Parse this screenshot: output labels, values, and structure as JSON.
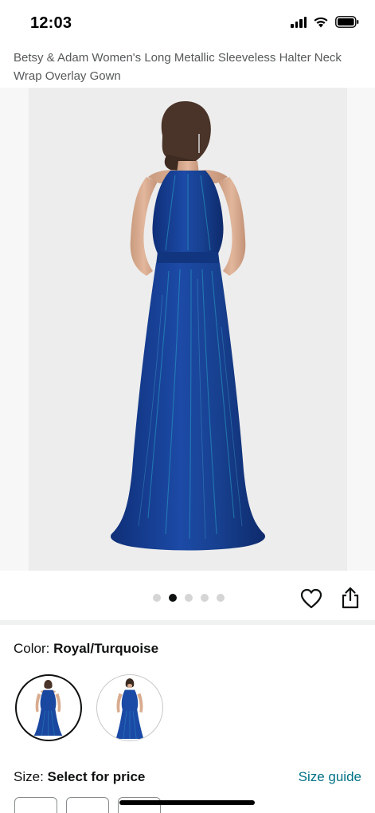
{
  "status_bar": {
    "time": "12:03"
  },
  "product": {
    "title": "Betsy & Adam Women's Long Metallic Sleeveless Halter Neck Wrap Overlay Gown"
  },
  "gallery": {
    "dot_count": 5,
    "active_index": 1,
    "photo_description_icon": "dress-photo"
  },
  "color": {
    "label": "Color:",
    "value": "Royal/Turquoise",
    "swatches": [
      {
        "name": "back-view",
        "selected": true
      },
      {
        "name": "front-view",
        "selected": false
      }
    ]
  },
  "size": {
    "label": "Size:",
    "value": "Select for price",
    "guide_link": "Size guide"
  },
  "colors": {
    "gown_dark": "#0f2f78",
    "gown_mid": "#1c4aa6",
    "gown_sheen": "#2aa3c7",
    "link": "#007185",
    "title_gray": "#565959"
  }
}
